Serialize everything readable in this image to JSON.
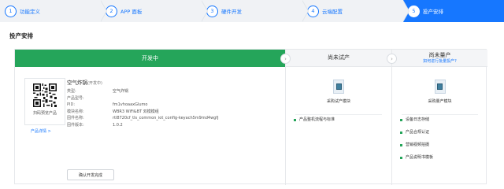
{
  "steps": [
    {
      "num": "1",
      "label": "功能定义"
    },
    {
      "num": "2",
      "label": "APP 面板"
    },
    {
      "num": "3",
      "label": "硬件开发"
    },
    {
      "num": "4",
      "label": "云端配置"
    },
    {
      "num": "5",
      "label": "投产安排"
    }
  ],
  "page_title": "投产安排",
  "dev": {
    "status": "开发中",
    "product_name": "空气炸锅",
    "product_tag": "(开发中)",
    "fields": [
      {
        "k": "类型:",
        "v": "空气炸锅"
      },
      {
        "k": "产品型号:",
        "v": ""
      },
      {
        "k": "PID:",
        "v": "fm1vhoaaxGlumo"
      },
      {
        "k": "模块名称:",
        "v": "WBR3 WiFi&BT 双模模组"
      },
      {
        "k": "固件名称:",
        "v": "rtl8720cf_tls_common_iot_config-keyach5m9md4wgfj"
      },
      {
        "k": "固件版本:",
        "v": "1.0.2"
      }
    ],
    "qr_label": "扫码预览产品",
    "product_detail": "产品详情 >",
    "done_button": "确认开发完成"
  },
  "trial": {
    "status": "尚未试产",
    "module": "采购试产模块",
    "tasks": [
      "产品整机流程与标准"
    ]
  },
  "mass": {
    "status": "尚未量产",
    "link": "如何进行批量投产?",
    "module": "采购量产模块",
    "tasks": [
      "设备日志存储",
      "产品合规认证",
      "营销视频拍摄",
      "产品说明书模板"
    ]
  },
  "colors": {
    "accent": "#1677ff",
    "green": "#25a55a"
  }
}
